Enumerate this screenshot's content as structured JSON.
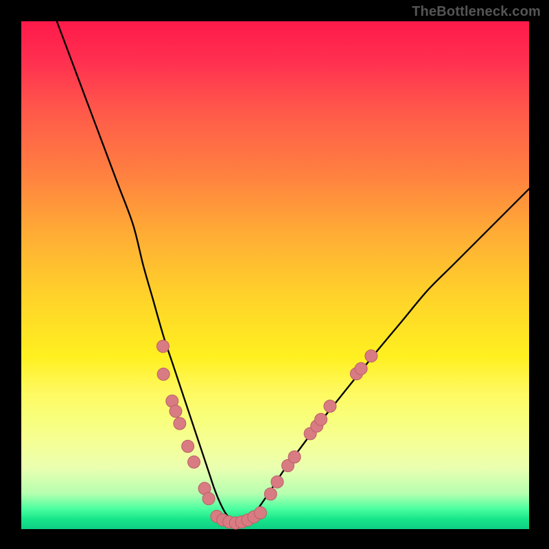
{
  "credit": {
    "text": "TheBottleneck.com"
  },
  "colors": {
    "bg": "#000000",
    "curve_stroke": "#000000",
    "marker_fill": "#d97b82",
    "marker_stroke": "#b85f66"
  },
  "chart_data": {
    "type": "line",
    "title": "",
    "xlabel": "",
    "ylabel": "",
    "xlim": [
      0,
      100
    ],
    "ylim": [
      0,
      100
    ],
    "grid": false,
    "series": [
      {
        "name": "bottleneck-curve",
        "x": [
          7,
          10,
          13,
          16,
          19,
          22,
          24,
          26,
          28,
          30,
          32,
          34,
          36,
          37,
          38,
          39,
          40,
          41,
          42,
          43,
          44,
          45,
          46,
          48,
          50,
          52,
          55,
          58,
          62,
          66,
          70,
          75,
          80,
          85,
          90,
          95,
          100
        ],
        "y": [
          100,
          92,
          84,
          76,
          68,
          60,
          52,
          45,
          38,
          32,
          26,
          20,
          14,
          11,
          8,
          5.5,
          3.5,
          2.2,
          1.5,
          1.2,
          1.4,
          2.0,
          3.2,
          6,
          9,
          12,
          16,
          20,
          25,
          30,
          35,
          41,
          47,
          52,
          57,
          62,
          67
        ]
      }
    ],
    "markers_left": [
      {
        "x": 27.9,
        "y": 36.0
      },
      {
        "x": 28.0,
        "y": 30.5
      },
      {
        "x": 29.7,
        "y": 25.2
      },
      {
        "x": 30.4,
        "y": 23.2
      },
      {
        "x": 31.2,
        "y": 20.8
      },
      {
        "x": 32.8,
        "y": 16.3
      },
      {
        "x": 34.0,
        "y": 13.2
      },
      {
        "x": 36.1,
        "y": 8.0
      },
      {
        "x": 36.9,
        "y": 6.0
      }
    ],
    "markers_bottom": [
      {
        "x": 38.5,
        "y": 2.5
      },
      {
        "x": 39.7,
        "y": 1.8
      },
      {
        "x": 40.9,
        "y": 1.4
      },
      {
        "x": 42.2,
        "y": 1.2
      },
      {
        "x": 43.4,
        "y": 1.4
      },
      {
        "x": 44.6,
        "y": 1.8
      },
      {
        "x": 45.8,
        "y": 2.4
      },
      {
        "x": 47.1,
        "y": 3.2
      }
    ],
    "markers_right": [
      {
        "x": 49.1,
        "y": 6.9
      },
      {
        "x": 50.4,
        "y": 9.3
      },
      {
        "x": 52.5,
        "y": 12.5
      },
      {
        "x": 53.8,
        "y": 14.2
      },
      {
        "x": 56.9,
        "y": 18.8
      },
      {
        "x": 58.2,
        "y": 20.3
      },
      {
        "x": 59.0,
        "y": 21.6
      },
      {
        "x": 60.8,
        "y": 24.2
      },
      {
        "x": 66.0,
        "y": 30.6
      },
      {
        "x": 66.9,
        "y": 31.6
      },
      {
        "x": 68.9,
        "y": 34.1
      }
    ]
  }
}
